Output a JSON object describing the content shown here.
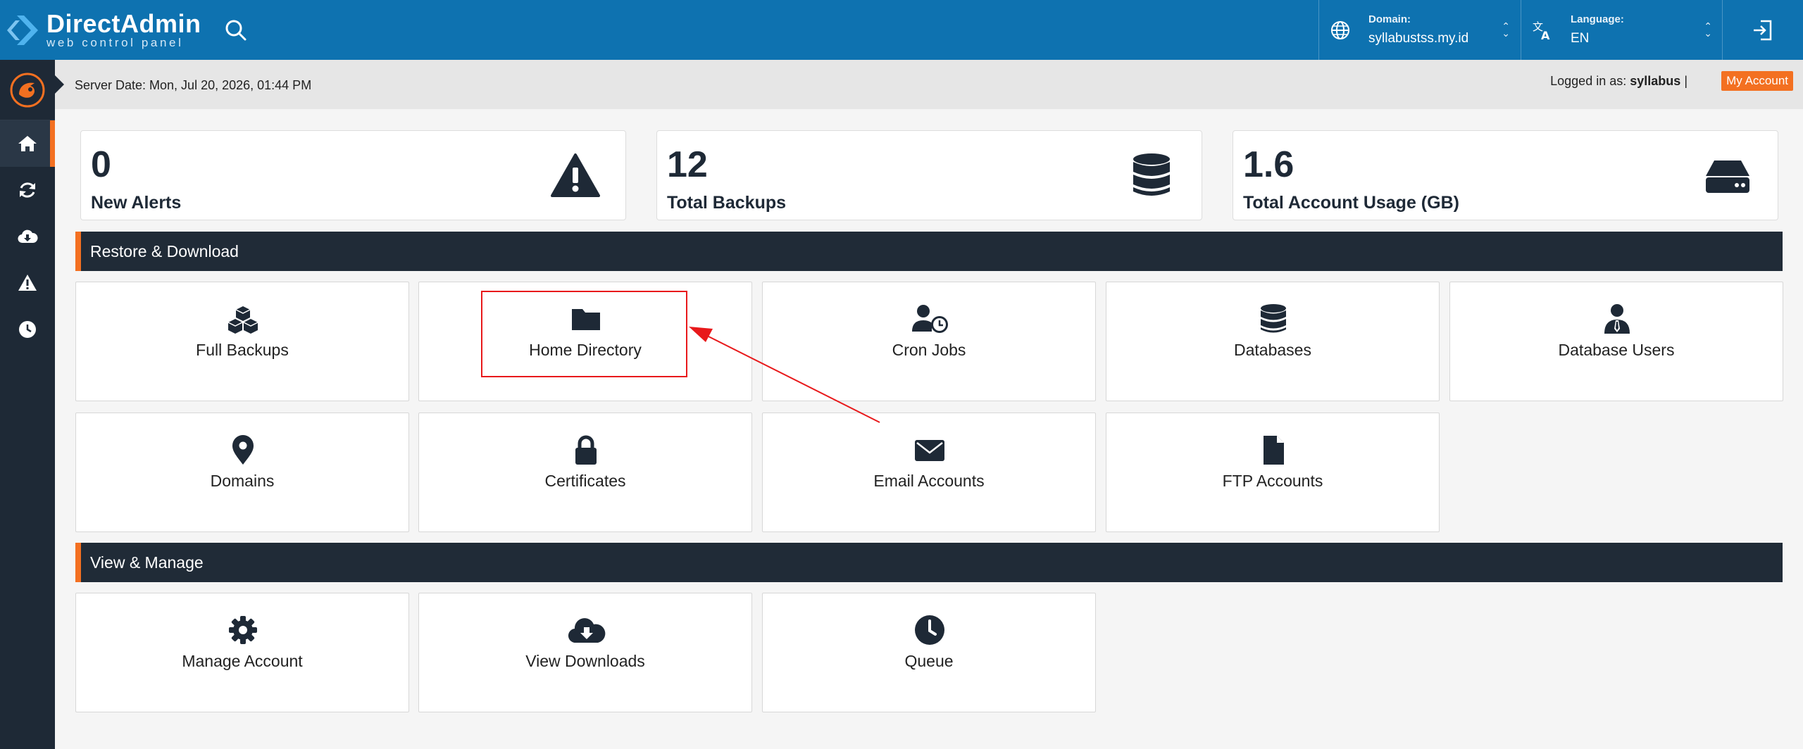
{
  "brand": {
    "title": "DirectAdmin",
    "subtitle": "web control panel"
  },
  "header": {
    "domain": {
      "label": "Domain:",
      "value": "syllabustss.my.id"
    },
    "language": {
      "label": "Language:",
      "value": "EN"
    }
  },
  "infobar": {
    "server_date": "Server Date: Mon, Jul 20, 2026, 01:44 PM",
    "logged_prefix": "Logged in as:",
    "username": "syllabus",
    "separator": "|",
    "my_account": "My Account"
  },
  "sidebar": {
    "items": [
      {
        "icon": "home-icon"
      },
      {
        "icon": "refresh-icon"
      },
      {
        "icon": "cloud-download-icon"
      },
      {
        "icon": "warning-icon"
      },
      {
        "icon": "clock-icon"
      }
    ]
  },
  "stats": [
    {
      "value": "0",
      "label": "New Alerts",
      "icon": "warning-icon"
    },
    {
      "value": "12",
      "label": "Total Backups",
      "icon": "database-icon"
    },
    {
      "value": "1.6",
      "label": "Total Account Usage (GB)",
      "icon": "hard-drive-icon"
    }
  ],
  "sections": {
    "restore": {
      "title": "Restore & Download",
      "tiles": [
        {
          "label": "Full Backups",
          "icon": "cubes-icon"
        },
        {
          "label": "Home Directory",
          "icon": "folder-icon"
        },
        {
          "label": "Cron Jobs",
          "icon": "user-clock-icon"
        },
        {
          "label": "Databases",
          "icon": "database-icon"
        },
        {
          "label": "Database Users",
          "icon": "user-tie-icon"
        },
        {
          "label": "Domains",
          "icon": "map-marker-icon"
        },
        {
          "label": "Certificates",
          "icon": "lock-icon"
        },
        {
          "label": "Email Accounts",
          "icon": "envelope-icon"
        },
        {
          "label": "FTP Accounts",
          "icon": "file-icon"
        }
      ]
    },
    "view": {
      "title": "View & Manage",
      "tiles": [
        {
          "label": "Manage Account",
          "icon": "gear-icon"
        },
        {
          "label": "View Downloads",
          "icon": "cloud-download-icon"
        },
        {
          "label": "Queue",
          "icon": "clock-icon"
        }
      ]
    }
  },
  "colors": {
    "header_blue": "#0e72b0",
    "sidebar_dark": "#1e2936",
    "accent_orange": "#f37021",
    "annotation_red": "#e8191b"
  }
}
